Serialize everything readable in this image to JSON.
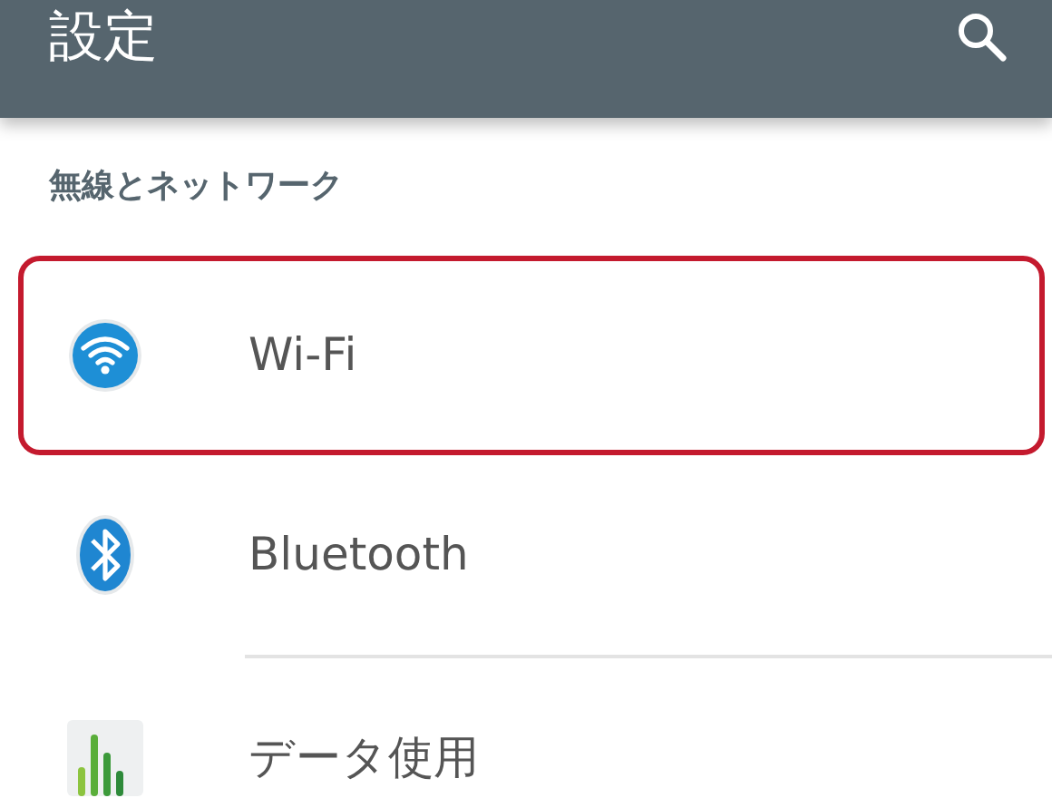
{
  "app_bar": {
    "title": "設定"
  },
  "section": {
    "title": "無線とネットワーク"
  },
  "items": [
    {
      "kind": "wifi",
      "label": "Wi-Fi",
      "highlighted": true
    },
    {
      "kind": "bluetooth",
      "label": "Bluetooth",
      "highlighted": false
    },
    {
      "kind": "data",
      "label": "データ使用",
      "highlighted": false
    }
  ]
}
